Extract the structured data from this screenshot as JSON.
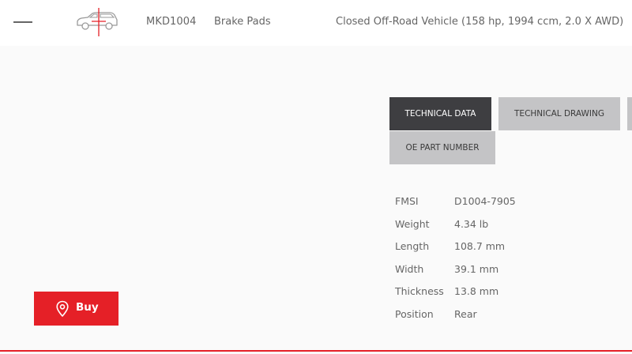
{
  "header": {
    "part_code": "MKD1004",
    "part_name": "Brake Pads",
    "vehicle": "Closed Off-Road Vehicle (158 hp, 1994 ccm, 2.0 X AWD)"
  },
  "tabs": [
    {
      "label": "TECHNICAL DATA",
      "active": true
    },
    {
      "label": "TECHNICAL DRAWING",
      "active": false
    },
    {
      "label": "",
      "active": false
    },
    {
      "label": "OE PART NUMBER",
      "active": false
    }
  ],
  "specs": [
    {
      "label": "FMSI",
      "value": "D1004-7905"
    },
    {
      "label": "Weight",
      "value": "4.34 lb"
    },
    {
      "label": "Length",
      "value": "108.7 mm"
    },
    {
      "label": "Width",
      "value": "39.1 mm"
    },
    {
      "label": "Thickness",
      "value": "13.8 mm"
    },
    {
      "label": "Position",
      "value": "Rear"
    }
  ],
  "buy_button": {
    "label": "Buy",
    "icon": "location-pin-icon"
  },
  "colors": {
    "accent": "#e52027",
    "tab_active": "#3e3e41",
    "tab_inactive": "#c4c4c6"
  }
}
